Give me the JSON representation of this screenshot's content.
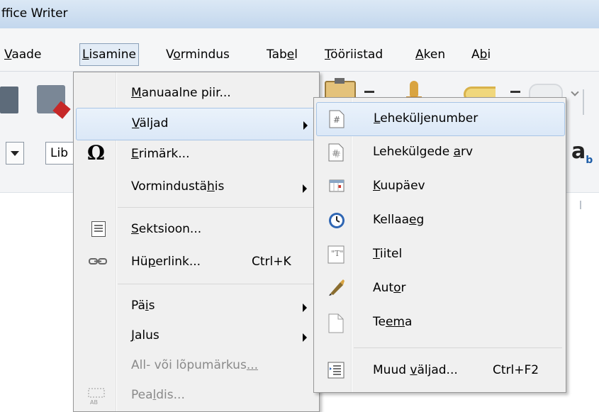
{
  "window": {
    "title": "ffice Writer"
  },
  "menubar": [
    {
      "before": "",
      "u": "V",
      "after": "aade"
    },
    {
      "before": "",
      "u": "L",
      "after": "isamine",
      "active": true
    },
    {
      "before": "V",
      "u": "o",
      "after": "rmindus"
    },
    {
      "before": "Tab",
      "u": "e",
      "after": "l"
    },
    {
      "before": "",
      "u": "T",
      "after": "ööriistad"
    },
    {
      "before": "",
      "u": "A",
      "after": "ken"
    },
    {
      "before": "A",
      "u": "b",
      "after": "i"
    }
  ],
  "toolbar": {
    "font_name": "Lib"
  },
  "insert_menu": {
    "items": [
      {
        "before": "",
        "u": "M",
        "after": "anuaalne piir...",
        "icon": "",
        "submenu": false,
        "disabled": false
      },
      {
        "before": "",
        "u": "V",
        "after": "äljad",
        "icon": "",
        "submenu": true,
        "hover": true
      },
      {
        "before": "",
        "u": "E",
        "after": "rimärk...",
        "icon": "omega-icon",
        "submenu": false
      },
      {
        "before": "Vormindustä",
        "u": "h",
        "after": "is",
        "icon": "",
        "submenu": true
      },
      {
        "before": "",
        "u": "S",
        "after": "ektsioon...",
        "icon": "section-icon",
        "submenu": false
      },
      {
        "before": "Hü",
        "u": "p",
        "after": "erlink...",
        "icon": "hyperlink-icon",
        "submenu": false,
        "shortcut": "Ctrl+K"
      },
      {
        "before": "Pä",
        "u": "i",
        "after": "s",
        "icon": "",
        "submenu": true
      },
      {
        "before": "",
        "u": "J",
        "after": "alus",
        "icon": "",
        "submenu": true
      },
      {
        "before": "All- või lõpumärkus",
        "u": "...",
        "after": "",
        "icon": "",
        "submenu": false,
        "disabled": true
      },
      {
        "before": "Pea",
        "u": "l",
        "after": "dis...",
        "icon": "caption-icon",
        "submenu": false,
        "disabled": true
      }
    ]
  },
  "fields_submenu": {
    "items": [
      {
        "before": "",
        "u": "L",
        "after": "eheküljenumber",
        "icon": "page-number-icon",
        "hover": true
      },
      {
        "before": "Lehekülgede ",
        "u": "a",
        "after": "rv",
        "icon": "page-count-icon"
      },
      {
        "before": "",
        "u": "K",
        "after": "uupäev",
        "icon": "calendar-icon"
      },
      {
        "before": "Kellaa",
        "u": "e",
        "after": "g",
        "icon": "clock-icon"
      },
      {
        "before": "",
        "u": "T",
        "after": "iitel",
        "icon": "title-icon"
      },
      {
        "before": "Aut",
        "u": "o",
        "after": "r",
        "icon": "author-icon"
      },
      {
        "before": "Te",
        "u": "em",
        "after": "a",
        "icon": "subject-icon"
      },
      {
        "before": "Muud ",
        "u": "v",
        "after": "äljad...",
        "icon": "more-fields-icon",
        "shortcut": "Ctrl+F2"
      }
    ]
  }
}
